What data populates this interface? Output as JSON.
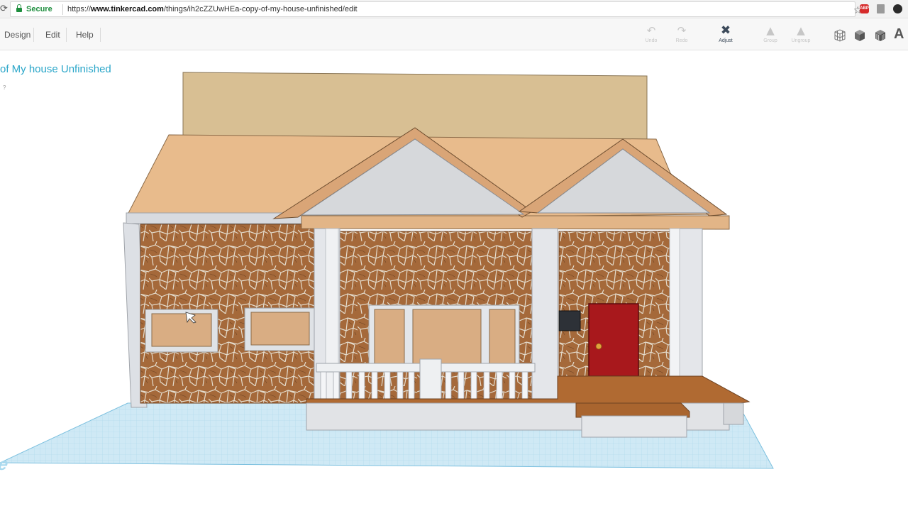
{
  "browser": {
    "reload_glyph": "⟳",
    "secure_label": "Secure",
    "url_prefix": "https://",
    "url_host": "www.tinkercad.com",
    "url_path": "/things/ih2cZZUwHEa-copy-of-my-house-unfinished/edit",
    "icons": [
      "reload-icon",
      "lock-icon",
      "bookmark-star-icon",
      "adblock-extension-icon",
      "document-extension-icon",
      "profile-extension-icon"
    ]
  },
  "menu": {
    "design": "Design",
    "edit": "Edit",
    "help": "Help"
  },
  "tools": {
    "undo": {
      "label": "Undo",
      "glyph": "↶"
    },
    "redo": {
      "label": "Redo",
      "glyph": "↷"
    },
    "adjust": {
      "label": "Adjust",
      "glyph": "✖"
    },
    "group": {
      "label": "Group",
      "glyph": "▲"
    },
    "ungroup": {
      "label": "Ungroup",
      "glyph": "▲"
    }
  },
  "view_icons": [
    "wireframe-view-icon",
    "solid-box-icon",
    "textured-box-icon",
    "text-shape-icon"
  ],
  "text_shape_glyph": "A",
  "design_title": "of My house Unfinished",
  "help_hint": "?",
  "workplane_label": "Workplane",
  "colors": {
    "brand_teal": "#2aa6c9",
    "secure_green": "#1e8e3e",
    "roof_tan": "#e8bb8c",
    "stone_brown": "#a5693a",
    "door_red": "#a8181c",
    "workplane_blue": "#bfe3f2"
  }
}
